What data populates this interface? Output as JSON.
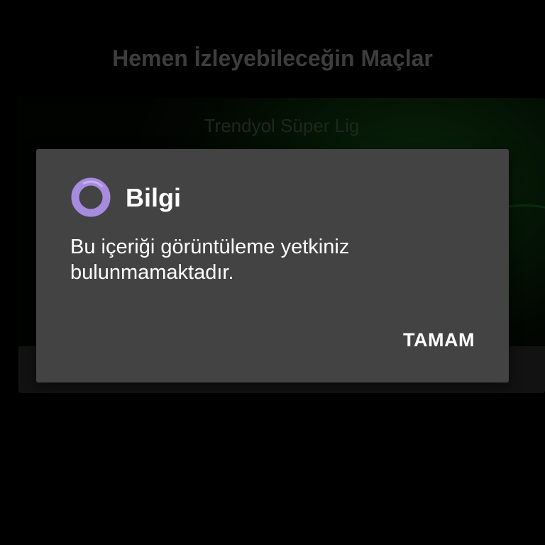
{
  "page": {
    "title": "Hemen İzleyebileceğin Maçlar"
  },
  "match_card": {
    "league": "Trendyol Süper Lig"
  },
  "dialog": {
    "icon": "ring-icon",
    "icon_color": "#a78bdf",
    "title": "Bilgi",
    "message": "Bu içeriği görüntüleme yetkiniz bulunmamaktadır.",
    "button_label": "TAMAM"
  },
  "colors": {
    "background": "#000000",
    "dialog_background": "#434343",
    "text": "#ffffff",
    "accent": "#a78bdf"
  }
}
